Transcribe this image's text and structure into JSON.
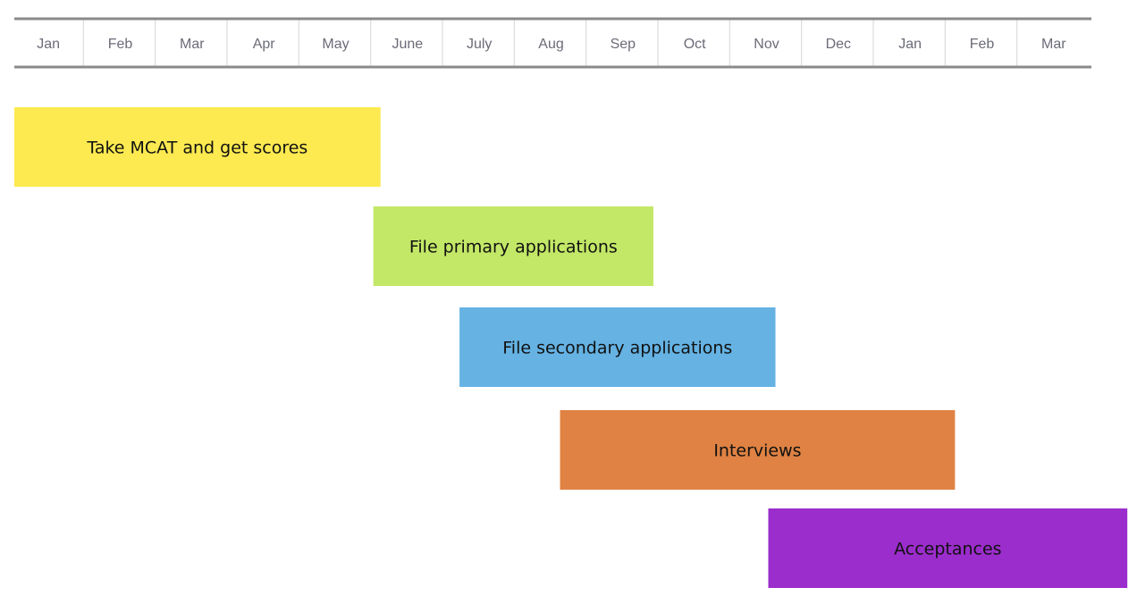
{
  "chart_data": {
    "type": "gantt",
    "title": "",
    "xlabel": "",
    "ylabel": "",
    "months": [
      "Jan",
      "Feb",
      "Mar",
      "Apr",
      "May",
      "June",
      "July",
      "Aug",
      "Sep",
      "Oct",
      "Nov",
      "Dec",
      "Jan",
      "Feb",
      "Mar"
    ],
    "x_unit": "month index (0 = start of first Jan)",
    "xlim": [
      0,
      15
    ],
    "grid": false,
    "legend": "none",
    "tasks": [
      {
        "label": "Take MCAT and get scores",
        "start": 0.0,
        "end": 5.1,
        "color": "#fdea50"
      },
      {
        "label": "File primary applications",
        "start": 5.0,
        "end": 8.9,
        "color": "#c3e867"
      },
      {
        "label": "File secondary applications",
        "start": 6.2,
        "end": 10.6,
        "color": "#65b2e3"
      },
      {
        "label": "Interviews",
        "start": 7.6,
        "end": 13.1,
        "color": "#df8243"
      },
      {
        "label": "Acceptances",
        "start": 10.5,
        "end": 15.5,
        "color": "#9b2dcc"
      }
    ]
  },
  "colors": {
    "header_rule": "#8a8a8a",
    "header_divider": "#dcdcdc",
    "month_text": "#6b6b78",
    "bar_text": "#111111"
  }
}
